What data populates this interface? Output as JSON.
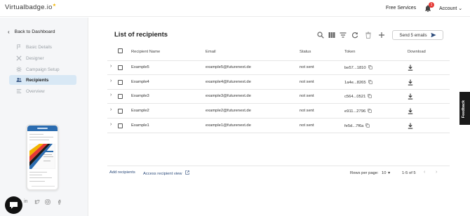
{
  "header": {
    "logo_main": "Virtualbadge",
    "logo_suffix": ".io",
    "free_services": "Free Services",
    "notification_count": "1",
    "account": "Account"
  },
  "sidebar": {
    "back_label": "Back to Dashboard",
    "items": [
      {
        "label": "Basic Details",
        "icon": "flag-icon",
        "active": false
      },
      {
        "label": "Designer",
        "icon": "tools-icon",
        "active": false
      },
      {
        "label": "Campaign Setup",
        "icon": "gear-icon",
        "active": false
      },
      {
        "label": "Recipients",
        "icon": "people-icon",
        "active": true
      },
      {
        "label": "Overview",
        "icon": "list-icon",
        "active": false
      }
    ]
  },
  "main": {
    "title": "List of recipients",
    "send_button": "Send 5 emails",
    "columns": [
      "Recipient Name",
      "Email",
      "Status",
      "Token",
      "Download"
    ],
    "rows": [
      {
        "name": "Example5",
        "email": "example5@futurenext.de",
        "status": "not sent",
        "token": "be57...1810"
      },
      {
        "name": "Example4",
        "email": "example4@futurenext.de",
        "status": "not sent",
        "token": "1a4e...8265"
      },
      {
        "name": "Example3",
        "email": "example3@futurenext.de",
        "status": "not sent",
        "token": "c564...0521"
      },
      {
        "name": "Example2",
        "email": "example2@futurenext.de",
        "status": "not sent",
        "token": "e911...2796"
      },
      {
        "name": "Example1",
        "email": "example1@futurenext.de",
        "status": "not sent",
        "token": "fe5d...7f6a"
      }
    ],
    "footer": {
      "add_recipients": "Add recipients",
      "access_view": "Access recipient view",
      "rows_per_page_label": "Rows per page:",
      "rows_per_page_value": "10",
      "range": "1-5 of 5"
    }
  },
  "feedback": "Feedback",
  "colors": {
    "accent": "#2b6cb0",
    "active_bg": "#d8e8f5",
    "danger": "#e53935"
  }
}
